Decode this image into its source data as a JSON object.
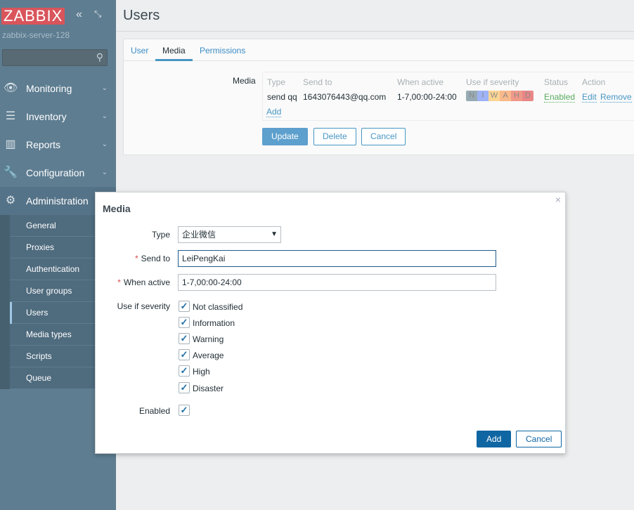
{
  "logo": "ZABBIX",
  "server": "zabbix-server-128",
  "menu": [
    {
      "label": "Monitoring",
      "icon": "👁"
    },
    {
      "label": "Inventory",
      "icon": "☰"
    },
    {
      "label": "Reports",
      "icon": "▥"
    },
    {
      "label": "Configuration",
      "icon": "🔧"
    },
    {
      "label": "Administration",
      "icon": "⚙"
    }
  ],
  "submenu": [
    "General",
    "Proxies",
    "Authentication",
    "User groups",
    "Users",
    "Media types",
    "Scripts",
    "Queue"
  ],
  "page_title": "Users",
  "tabs": [
    "User",
    "Media",
    "Permissions"
  ],
  "media_label": "Media",
  "table": {
    "headers": [
      "Type",
      "Send to",
      "When active",
      "Use if severity",
      "Status",
      "Action"
    ],
    "row": {
      "type": "send qq",
      "send_to": "1643076443@qq.com",
      "when_active": "1-7,00:00-24:00",
      "severity": [
        "N",
        "I",
        "W",
        "A",
        "H",
        "D"
      ],
      "status": "Enabled",
      "edit": "Edit",
      "remove": "Remove"
    },
    "add": "Add"
  },
  "buttons": {
    "update": "Update",
    "delete": "Delete",
    "cancel": "Cancel"
  },
  "severity_colors": [
    "#97aab3",
    "#7499ff",
    "#ffc859",
    "#ffa059",
    "#e97659",
    "#e45959"
  ],
  "dialog": {
    "title": "Media",
    "close": "×",
    "type_label": "Type",
    "type_value": "企业微信",
    "send_to_label": "Send to",
    "send_to_value": "LeiPengKai",
    "when_active_label": "When active",
    "when_active_value": "1-7,00:00-24:00",
    "severity_label": "Use if severity",
    "severities": [
      "Not classified",
      "Information",
      "Warning",
      "Average",
      "High",
      "Disaster"
    ],
    "enabled_label": "Enabled",
    "required": "*",
    "add": "Add",
    "cancel": "Cancel"
  }
}
